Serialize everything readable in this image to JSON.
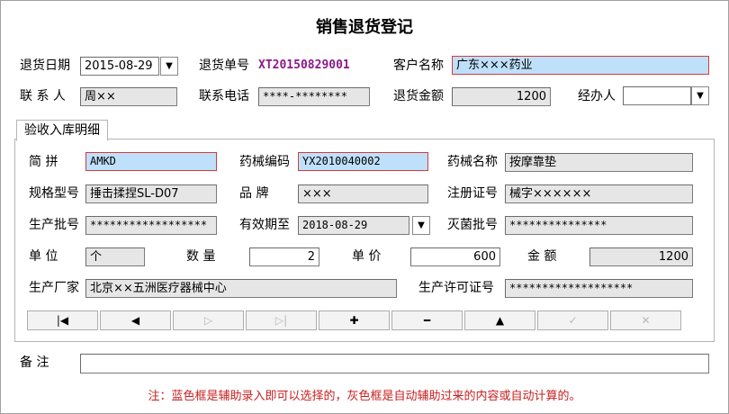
{
  "title": "销售退货登记",
  "header": {
    "return_date_label": "退货日期",
    "return_date_value": "2015-08-29",
    "return_no_label": "退货单号",
    "return_no_value": "XT20150829001",
    "customer_label": "客户名称",
    "customer_value": "广东×××药业",
    "contact_label": "联 系 人",
    "contact_value": "周××",
    "phone_label": "联系电话",
    "phone_value": "****-********",
    "amount_label": "退货金额",
    "amount_value": "1200",
    "handler_label": "经办人",
    "handler_value": ""
  },
  "tab": {
    "label": "验收入库明细"
  },
  "detail": {
    "pinyin_label": "简    拼",
    "pinyin_value": "AMKD",
    "code_label": "药械编码",
    "code_value": "YX2010040002",
    "name_label": "药械名称",
    "name_value": "按摩靠垫",
    "spec_label": "规格型号",
    "spec_value": "捶击揉捏SL-D07",
    "brand_label": "品    牌",
    "brand_value": "×××",
    "reg_label": "注册证号",
    "reg_value": "械字××××××",
    "batch_label": "生产批号",
    "batch_value": "******************",
    "expiry_label": "有效期至",
    "expiry_value": "2018-08-29",
    "steril_label": "灭菌批号",
    "steril_value": "***************",
    "unit_label": "单    位",
    "unit_value": "个",
    "qty_label": "数    量",
    "qty_value": "2",
    "price_label": "单    价",
    "price_value": "600",
    "amount_label": "金    额",
    "amount_value": "1200",
    "maker_label": "生产厂家",
    "maker_value": "北京××五洲医疗器械中心",
    "license_label": "生产许可证号",
    "license_value": "*******************"
  },
  "nav": {
    "buttons": [
      {
        "name": "first-record-button",
        "glyph": "|◀",
        "disabled": false
      },
      {
        "name": "prev-record-button",
        "glyph": "◀",
        "disabled": false
      },
      {
        "name": "next-record-button",
        "glyph": "▷",
        "disabled": true
      },
      {
        "name": "last-record-button",
        "glyph": "▷|",
        "disabled": true
      },
      {
        "name": "add-record-button",
        "glyph": "✚",
        "disabled": false
      },
      {
        "name": "delete-record-button",
        "glyph": "━",
        "disabled": false
      },
      {
        "name": "edit-record-button",
        "glyph": "▲",
        "disabled": false
      },
      {
        "name": "confirm-record-button",
        "glyph": "✓",
        "disabled": true
      },
      {
        "name": "cancel-record-button",
        "glyph": "✕",
        "disabled": true
      }
    ]
  },
  "remark": {
    "label": "备    注",
    "value": ""
  },
  "note": "注：蓝色框是辅助录入即可以选择的，灰色框是自动辅助过来的内容或自动计算的。",
  "colors": {
    "accent_text": "#8b1a8b",
    "highlight_bg": "#bfe0fb",
    "highlight_border": "#d43b3b",
    "note": "#c81e1e"
  }
}
